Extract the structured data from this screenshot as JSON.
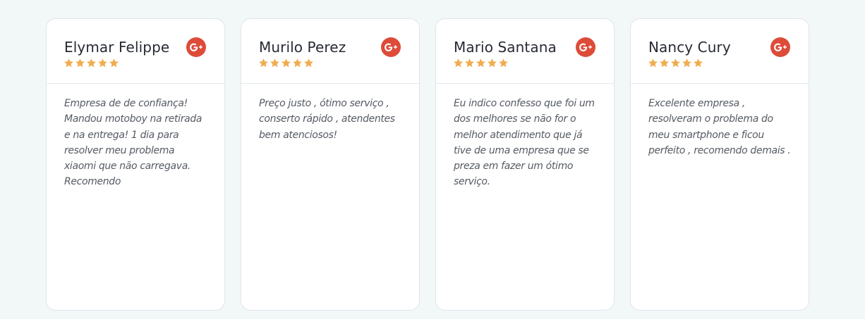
{
  "reviews": [
    {
      "name": "Elymar Felippe",
      "rating": 5,
      "source_icon": "google-plus-icon",
      "text": "Empresa de de confiança! Mandou motoboy na retirada e na entrega! 1 dia para resolver meu problema xiaomi que não carregava. Recomendo"
    },
    {
      "name": "Murilo Perez",
      "rating": 5,
      "source_icon": "google-plus-icon",
      "text": "Preço justo , ótimo serviço , conserto rápido , atendentes bem atenciosos!"
    },
    {
      "name": "Mario Santana",
      "rating": 5,
      "source_icon": "google-plus-icon",
      "text": "Eu indico confesso que foi um dos melhores se não for o melhor atendimento que já tive de uma empresa que se preza em fazer um ótimo serviço."
    },
    {
      "name": "Nancy Cury",
      "rating": 5,
      "source_icon": "google-plus-icon",
      "text": "Excelente empresa , resolveram o problema do meu smartphone e ficou perfeito , recomendo demais ."
    }
  ],
  "colors": {
    "background": "#f2f7f7",
    "card": "#ffffff",
    "star": "#f0ad4e",
    "google_plus": "#dd4b39",
    "name": "#262a33",
    "text": "#555b63"
  }
}
